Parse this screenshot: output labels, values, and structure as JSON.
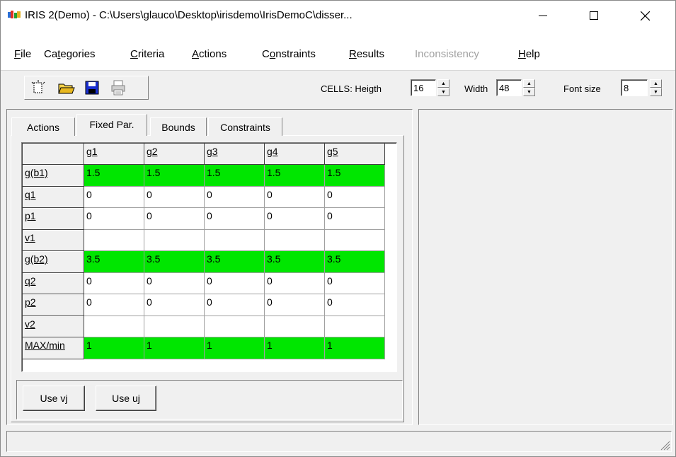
{
  "window": {
    "title": "IRIS 2(Demo)  -  C:\\Users\\glauco\\Desktop\\irisdemo\\IrisDemoC\\disser...",
    "minimize_icon": "minimize-icon",
    "maximize_icon": "maximize-icon",
    "close_icon": "close-icon"
  },
  "menu": {
    "file": "File",
    "categories": "Categories",
    "criteria": "Criteria",
    "actions": "Actions",
    "constraints": "Constraints",
    "results": "Results",
    "inconsistency": "Inconsistency",
    "help": "Help"
  },
  "toolbar": {
    "icons": [
      "new-file-icon",
      "open-folder-icon",
      "save-disk-icon",
      "print-icon"
    ],
    "cells_label": "CELLS: Heigth",
    "height_value": "16",
    "width_label": "Width",
    "width_value": "48",
    "font_label": "Font size",
    "font_value": "8"
  },
  "tabs": {
    "actions": "Actions",
    "fixed_par": "Fixed Par.",
    "bounds": "Bounds",
    "constraints": "Constraints",
    "active": "fixed_par"
  },
  "grid": {
    "columns": [
      "g1",
      "g2",
      "g3",
      "g4",
      "g5"
    ],
    "rows": [
      {
        "label": "g(b1)",
        "values": [
          "1.5",
          "1.5",
          "1.5",
          "1.5",
          "1.5"
        ],
        "highlight": true
      },
      {
        "label": "q1",
        "values": [
          "0",
          "0",
          "0",
          "0",
          "0"
        ],
        "highlight": false
      },
      {
        "label": "p1",
        "values": [
          "0",
          "0",
          "0",
          "0",
          "0"
        ],
        "highlight": false
      },
      {
        "label": "v1",
        "values": [
          "",
          "",
          "",
          "",
          ""
        ],
        "highlight": false
      },
      {
        "label": "g(b2)",
        "values": [
          "3.5",
          "3.5",
          "3.5",
          "3.5",
          "3.5"
        ],
        "highlight": true
      },
      {
        "label": "q2",
        "values": [
          "0",
          "0",
          "0",
          "0",
          "0"
        ],
        "highlight": false
      },
      {
        "label": "p2",
        "values": [
          "0",
          "0",
          "0",
          "0",
          "0"
        ],
        "highlight": false
      },
      {
        "label": "v2",
        "values": [
          "",
          "",
          "",
          "",
          ""
        ],
        "highlight": false
      },
      {
        "label": "MAX/min",
        "values": [
          "1",
          "1",
          "1",
          "1",
          "1"
        ],
        "highlight": true
      }
    ],
    "highlight_color": "#00e600"
  },
  "buttons": {
    "use_vj": "Use vj",
    "use_uj": "Use uj"
  }
}
